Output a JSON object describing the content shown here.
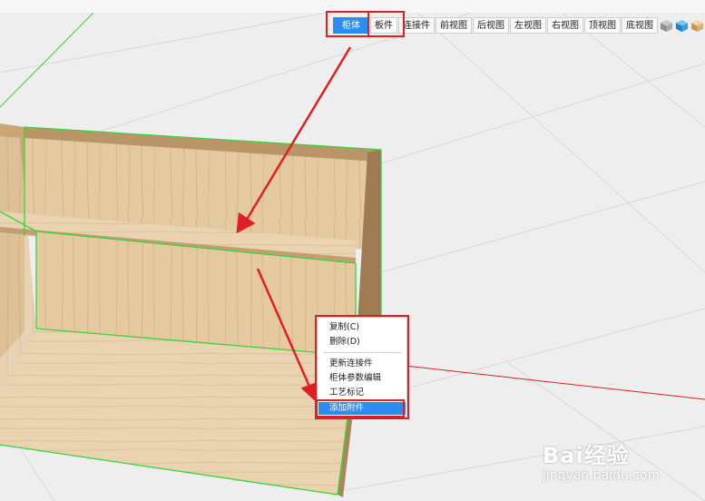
{
  "toolbar": {
    "items": [
      "柜体",
      "板件",
      "连接件",
      "前视图",
      "后视图",
      "左视图",
      "右视图",
      "顶视图",
      "底视图"
    ],
    "active_index": 0
  },
  "view_cubes": [
    "grey-cube-icon",
    "blue-cube-icon",
    "wood-cube-icon"
  ],
  "context_menu": {
    "items": [
      "复制(C)",
      "删除(D)",
      "更新连接件",
      "柜体参数编辑",
      "工艺标记",
      "添加附件"
    ],
    "selected_index": 5
  },
  "watermark": {
    "brand": "Bai经验",
    "url": "jingyan.baidu.com"
  },
  "colors": {
    "accent": "#2d8cf0",
    "highlight": "#e02020",
    "selection_outline": "#39d439",
    "wood": "#e3c79e",
    "background": "#eeeeee"
  }
}
